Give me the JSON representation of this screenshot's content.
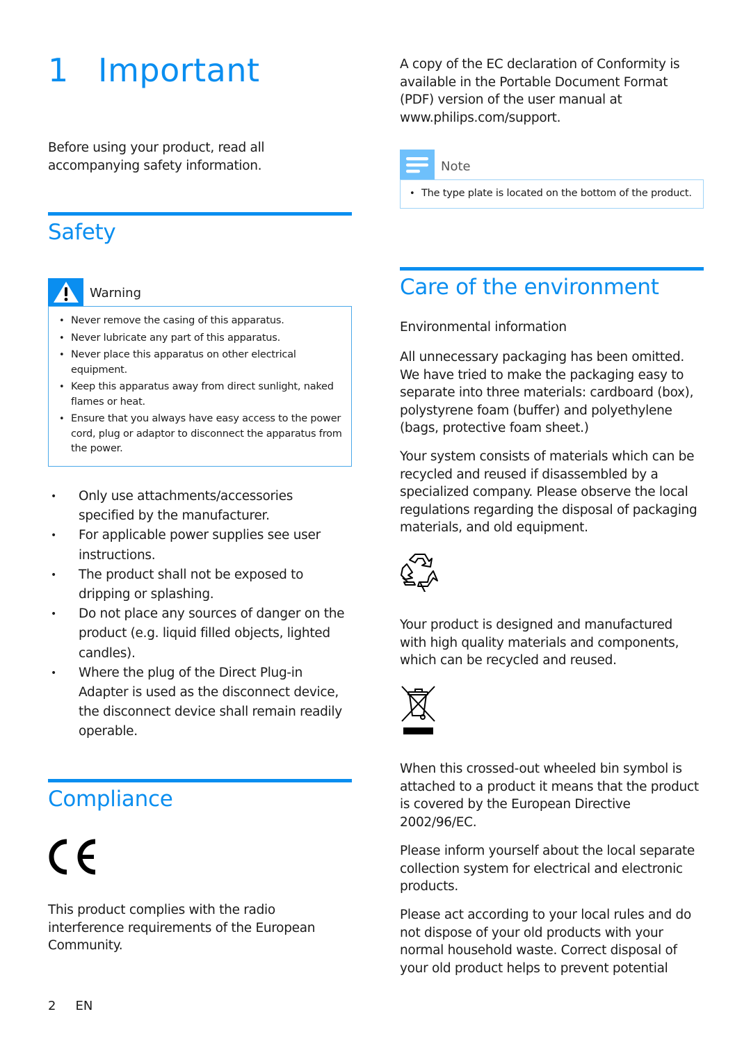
{
  "chapter": {
    "number": "1",
    "title": "Important"
  },
  "intro": "Before using your product, read all accompanying safety information.",
  "safety": {
    "title": "Safety",
    "warning": {
      "label": "Warning",
      "icon": "warning-triangle-icon",
      "items": [
        "Never remove the casing of this apparatus.",
        "Never lubricate any part of this apparatus.",
        "Never place this apparatus on other electrical equipment.",
        "Keep this apparatus away from direct sunlight, naked flames or heat.",
        "Ensure that you always have easy access to the power cord, plug or adaptor to disconnect the apparatus from the power."
      ]
    },
    "bullets": [
      "Only use attachments/accessories specified by the manufacturer.",
      "For applicable power supplies see user instructions.",
      "The product shall not be exposed to dripping or splashing.",
      "Do not place any sources of danger on the product (e.g. liquid filled objects, lighted candles).",
      "Where the plug of the Direct Plug-in Adapter is used as the disconnect device, the disconnect device shall remain readily operable."
    ]
  },
  "compliance": {
    "title": "Compliance",
    "mark_icon": "ce-mark-icon",
    "text": "This product complies with the radio interference requirements of the European Community."
  },
  "declaration": "A copy of the EC declaration of Conformity is available in the Portable Document Format (PDF) version of the user manual at www.philips.com/support.",
  "note": {
    "label": "Note",
    "icon": "note-lines-icon",
    "items": [
      "The type plate is located on the bottom of the product."
    ]
  },
  "environment": {
    "title": "Care of the environment",
    "subheading": "Environmental information",
    "paragraphs": [
      "All unnecessary packaging has been omitted. We have tried to make the packaging easy to separate into three materials: cardboard (box), polystyrene foam (buffer) and polyethylene (bags, protective foam sheet.)",
      "Your system consists of materials which can be recycled and reused if disassembled by a specialized company. Please observe the local regulations regarding the disposal of packaging materials, and old equipment."
    ],
    "recycle_icon": "recycle-icon",
    "product_text": "Your product is designed and manufactured with high quality materials and components, which can be recycled and reused.",
    "weee_icon": "crossed-out-wheeled-bin-icon",
    "weee_paragraphs": [
      "When this crossed-out wheeled bin symbol is attached to a product it means that the product is covered by the European Directive 2002/96/EC.",
      "Please inform yourself about the local separate collection system for electrical and electronic products.",
      "Please act according to your local rules and do not dispose of your old products with your normal household waste. Correct disposal of your old product helps to prevent potential"
    ]
  },
  "footer": {
    "page_number": "2",
    "language": "EN"
  },
  "colors": {
    "accent": "#0a8ef0",
    "note_accent": "#6ec0fb",
    "text": "#1a1a1a"
  }
}
